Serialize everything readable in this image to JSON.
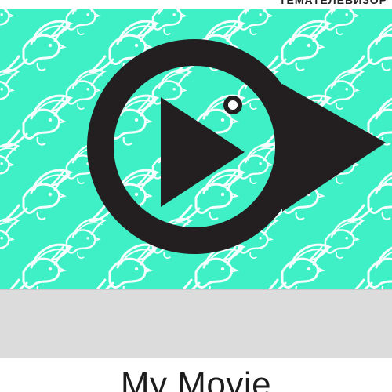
{
  "header": {
    "strip_text": "ТЕМАТЕЛЕВИЗОР"
  },
  "thumbnail": {
    "background_color": "#3ff0c6",
    "pattern_color": "#ffffff",
    "logo_color": "#231f20",
    "logo_icon": "play-bubble-logo",
    "pattern_icon": "flying-bird-pattern"
  },
  "movie": {
    "title": "My Movie"
  }
}
